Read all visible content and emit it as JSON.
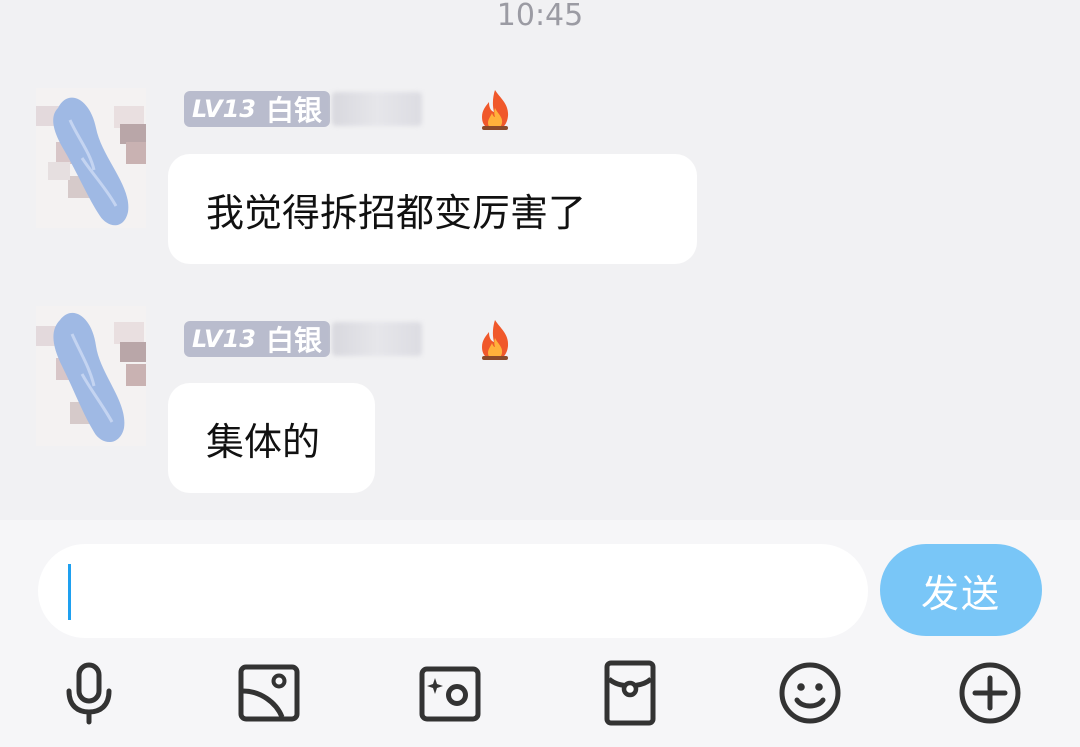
{
  "status_bar": {
    "time": "10:45"
  },
  "messages": [
    {
      "level": "LV13",
      "rank": "白银",
      "text": "我觉得拆招都变厉害了"
    },
    {
      "level": "LV13",
      "rank": "白银",
      "text": "集体的"
    }
  ],
  "composer": {
    "input_value": "",
    "send_label": "发送"
  },
  "toolbar": {
    "icons": [
      "microphone-icon",
      "image-icon",
      "camera-icon",
      "red-packet-icon",
      "emoji-icon",
      "plus-icon"
    ]
  },
  "colors": {
    "background": "#f1f1f3",
    "bubble": "#ffffff",
    "level_badge": "#b9bccd",
    "send_button": "#79c6f7",
    "caret": "#1ea0f0"
  }
}
